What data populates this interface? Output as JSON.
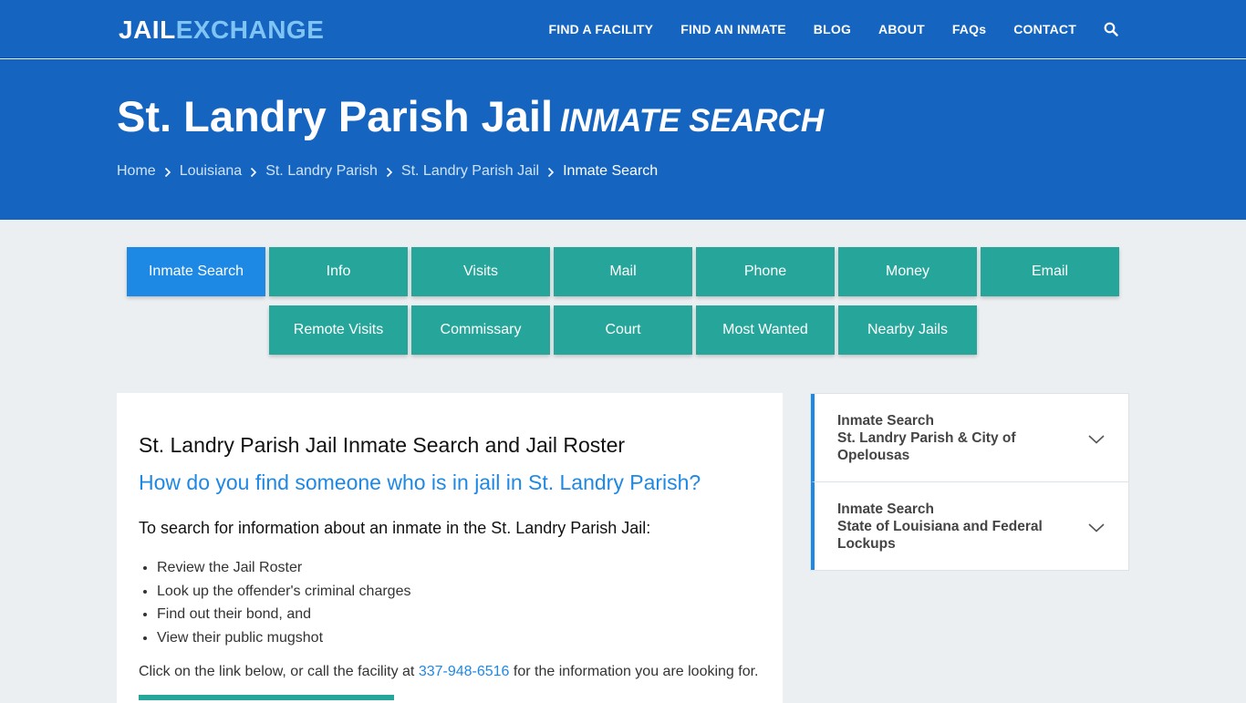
{
  "header": {
    "logo_part1": "JAIL",
    "logo_part2": "EXCHANGE",
    "nav": [
      "FIND A FACILITY",
      "FIND AN INMATE",
      "BLOG",
      "ABOUT",
      "FAQs",
      "CONTACT"
    ],
    "search_icon": "search-icon"
  },
  "hero": {
    "title": "St. Landry Parish Jail",
    "subtitle": "INMATE SEARCH",
    "breadcrumbs": [
      "Home",
      "Louisiana",
      "St. Landry Parish",
      "St. Landry Parish Jail",
      "Inmate Search"
    ]
  },
  "tabs": {
    "row1": [
      "Inmate Search",
      "Info",
      "Visits",
      "Mail",
      "Phone",
      "Money",
      "Email"
    ],
    "row2": [
      "Remote Visits",
      "Commissary",
      "Court",
      "Most Wanted",
      "Nearby Jails"
    ],
    "active": "Inmate Search"
  },
  "main": {
    "heading": "St. Landry Parish Jail Inmate Search and Jail Roster",
    "question": "How do you find someone who is in jail in St. Landry Parish?",
    "lead": "To search for information about an inmate in the St. Landry Parish Jail:",
    "bullets": [
      "Review the Jail Roster",
      "Look up the offender's criminal charges",
      "Find out their bond, and",
      "View their public mugshot"
    ],
    "call_before": "Click on the link below, or call the facility at",
    "phone": "337-948-6516",
    "call_after": "for the information you are looking for."
  },
  "sidebar": {
    "items": [
      {
        "line1": "Inmate Search",
        "line2": "St. Landry Parish & City of Opelousas"
      },
      {
        "line1": "Inmate Search",
        "line2": "State of Louisiana and Federal Lockups"
      }
    ]
  },
  "colors": {
    "primary": "#1565c0",
    "accent": "#1e88e5",
    "teal": "#26a69a",
    "logo_light": "#7fc4f5"
  }
}
